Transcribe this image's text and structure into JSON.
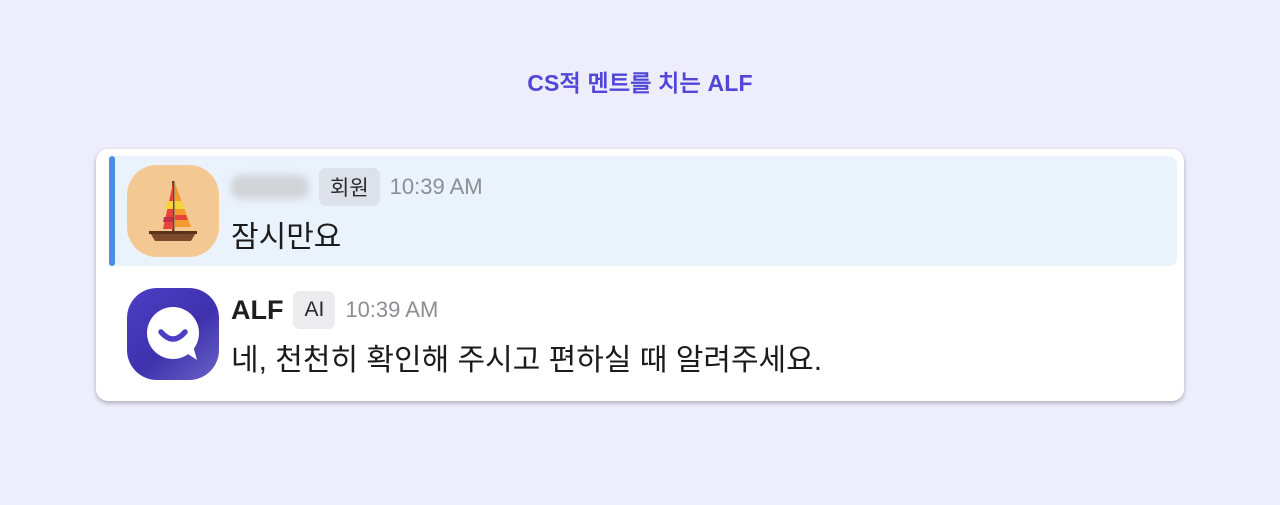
{
  "page": {
    "title": "CS적 멘트를 치는 ALF"
  },
  "messages": [
    {
      "author": "",
      "author_blurred": true,
      "badge": "회원",
      "time": "10:39 AM",
      "text": "잠시만요",
      "avatar_icon": "sailboat-icon",
      "highlighted": true
    },
    {
      "author": "ALF",
      "author_blurred": false,
      "badge": "AI",
      "time": "10:39 AM",
      "text": "네, 천천히 확인해 주시고 편하실 때 알려주세요.",
      "avatar_icon": "alf-chat-bubble-icon",
      "highlighted": false
    }
  ],
  "colors": {
    "background": "#eeedfc",
    "title": "#5146d8",
    "highlight_bg": "#eaf2fb",
    "accent_bar": "#4a90e2",
    "alf_brand": "#4c3fc4"
  }
}
